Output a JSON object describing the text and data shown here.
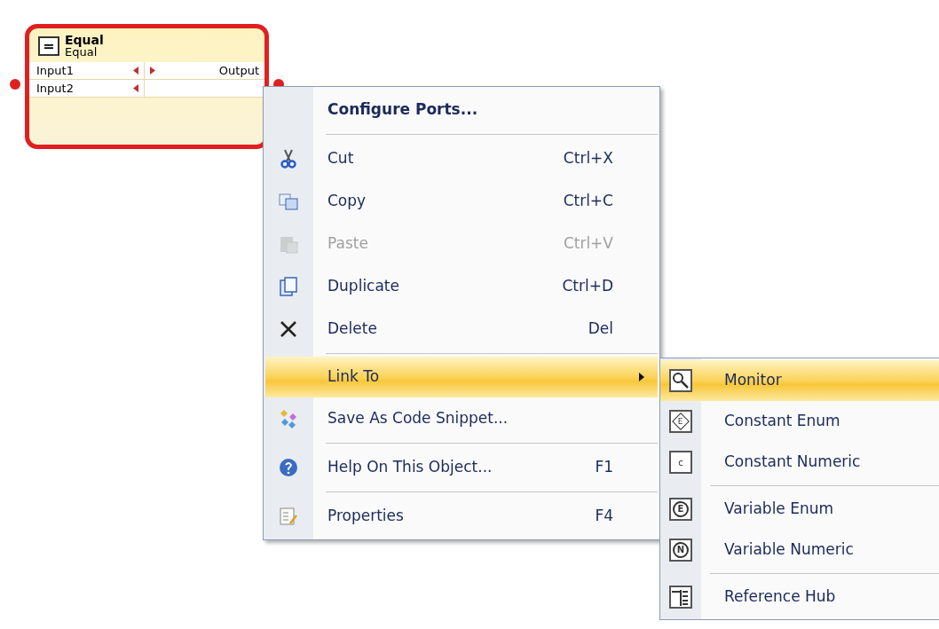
{
  "node": {
    "icon_glyph": "=",
    "title": "Equal",
    "subtitle": "Equal",
    "selected": true,
    "inputs": [
      "Input1",
      "Input2"
    ],
    "outputs": [
      "Output"
    ]
  },
  "context_menu": {
    "items": [
      {
        "kind": "header",
        "label": "Configure Ports..."
      },
      {
        "kind": "separator"
      },
      {
        "kind": "command",
        "label": "Cut",
        "shortcut": "Ctrl+X",
        "disabled": false
      },
      {
        "kind": "command",
        "label": "Copy",
        "shortcut": "Ctrl+C",
        "disabled": false
      },
      {
        "kind": "command",
        "label": "Paste",
        "shortcut": "Ctrl+V",
        "disabled": true
      },
      {
        "kind": "command",
        "label": "Duplicate",
        "shortcut": "Ctrl+D",
        "disabled": false
      },
      {
        "kind": "command",
        "label": "Delete",
        "shortcut": "Del",
        "disabled": false
      },
      {
        "kind": "separator"
      },
      {
        "kind": "submenu",
        "label": "Link To",
        "selected": true
      },
      {
        "kind": "command",
        "label": "Save As Code Snippet...",
        "disabled": false
      },
      {
        "kind": "separator"
      },
      {
        "kind": "command",
        "label": "Help On This Object...",
        "shortcut": "F1",
        "disabled": false
      },
      {
        "kind": "separator"
      },
      {
        "kind": "command",
        "label": "Properties",
        "shortcut": "F4",
        "disabled": false
      }
    ]
  },
  "submenu": {
    "items": [
      {
        "kind": "command",
        "label": "Monitor",
        "selected": true
      },
      {
        "kind": "command",
        "icon_glyph": "E",
        "label": "Constant Enum",
        "selected": false
      },
      {
        "kind": "command",
        "icon_glyph": "c",
        "label": "Constant Numeric",
        "selected": false
      },
      {
        "kind": "separator"
      },
      {
        "kind": "command",
        "icon_glyph": "E",
        "label": "Variable Enum",
        "selected": false
      },
      {
        "kind": "command",
        "icon_glyph": "N",
        "label": "Variable Numeric",
        "selected": false
      },
      {
        "kind": "separator"
      },
      {
        "kind": "command",
        "label": "Reference Hub",
        "selected": false
      }
    ]
  }
}
